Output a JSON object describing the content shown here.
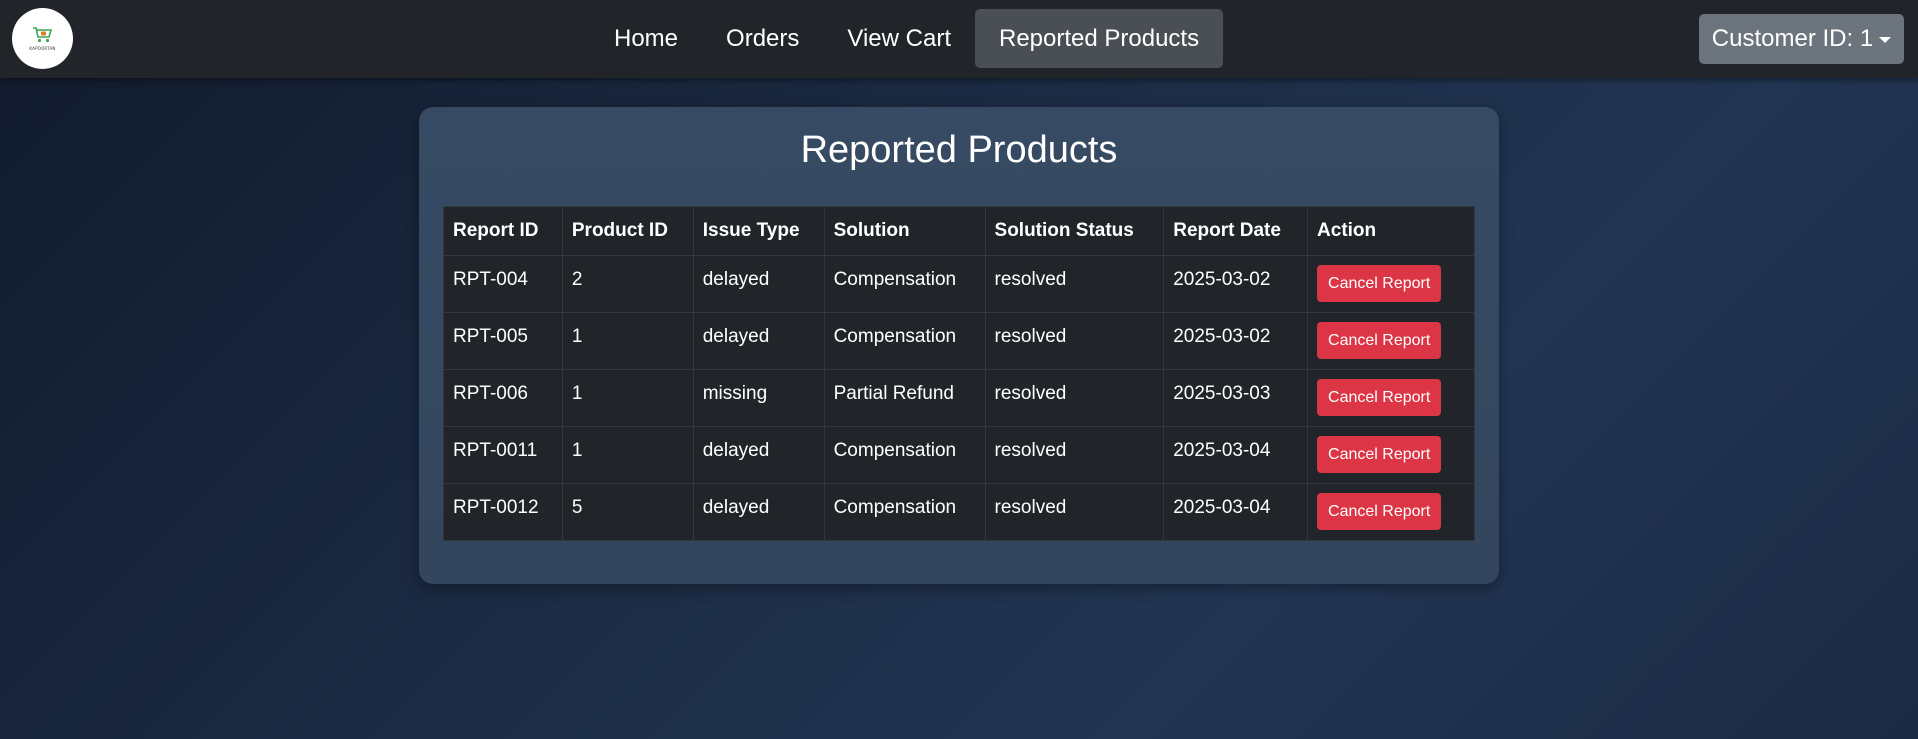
{
  "nav": {
    "logo_text": "KAPOORTAN",
    "links": [
      "Home",
      "Orders",
      "View Cart",
      "Reported Products"
    ],
    "active_index": 3,
    "customer_label": "Customer ID: 1"
  },
  "page": {
    "title": "Reported Products"
  },
  "table": {
    "headers": [
      "Report ID",
      "Product ID",
      "Issue Type",
      "Solution",
      "Solution Status",
      "Report Date",
      "Action"
    ],
    "rows": [
      {
        "report_id": "RPT-004",
        "product_id": "2",
        "issue_type": "delayed",
        "solution": "Compensation",
        "status": "resolved",
        "date": "2025-03-02",
        "action": "Cancel Report"
      },
      {
        "report_id": "RPT-005",
        "product_id": "1",
        "issue_type": "delayed",
        "solution": "Compensation",
        "status": "resolved",
        "date": "2025-03-02",
        "action": "Cancel Report"
      },
      {
        "report_id": "RPT-006",
        "product_id": "1",
        "issue_type": "missing",
        "solution": "Partial Refund",
        "status": "resolved",
        "date": "2025-03-03",
        "action": "Cancel Report"
      },
      {
        "report_id": "RPT-0011",
        "product_id": "1",
        "issue_type": "delayed",
        "solution": "Compensation",
        "status": "resolved",
        "date": "2025-03-04",
        "action": "Cancel Report"
      },
      {
        "report_id": "RPT-0012",
        "product_id": "5",
        "issue_type": "delayed",
        "solution": "Compensation",
        "status": "resolved",
        "date": "2025-03-04",
        "action": "Cancel Report"
      }
    ]
  },
  "colors": {
    "navbar": "#212529",
    "danger": "#dc3545",
    "secondary": "#6c757d",
    "active_nav": "#4a4f55"
  }
}
